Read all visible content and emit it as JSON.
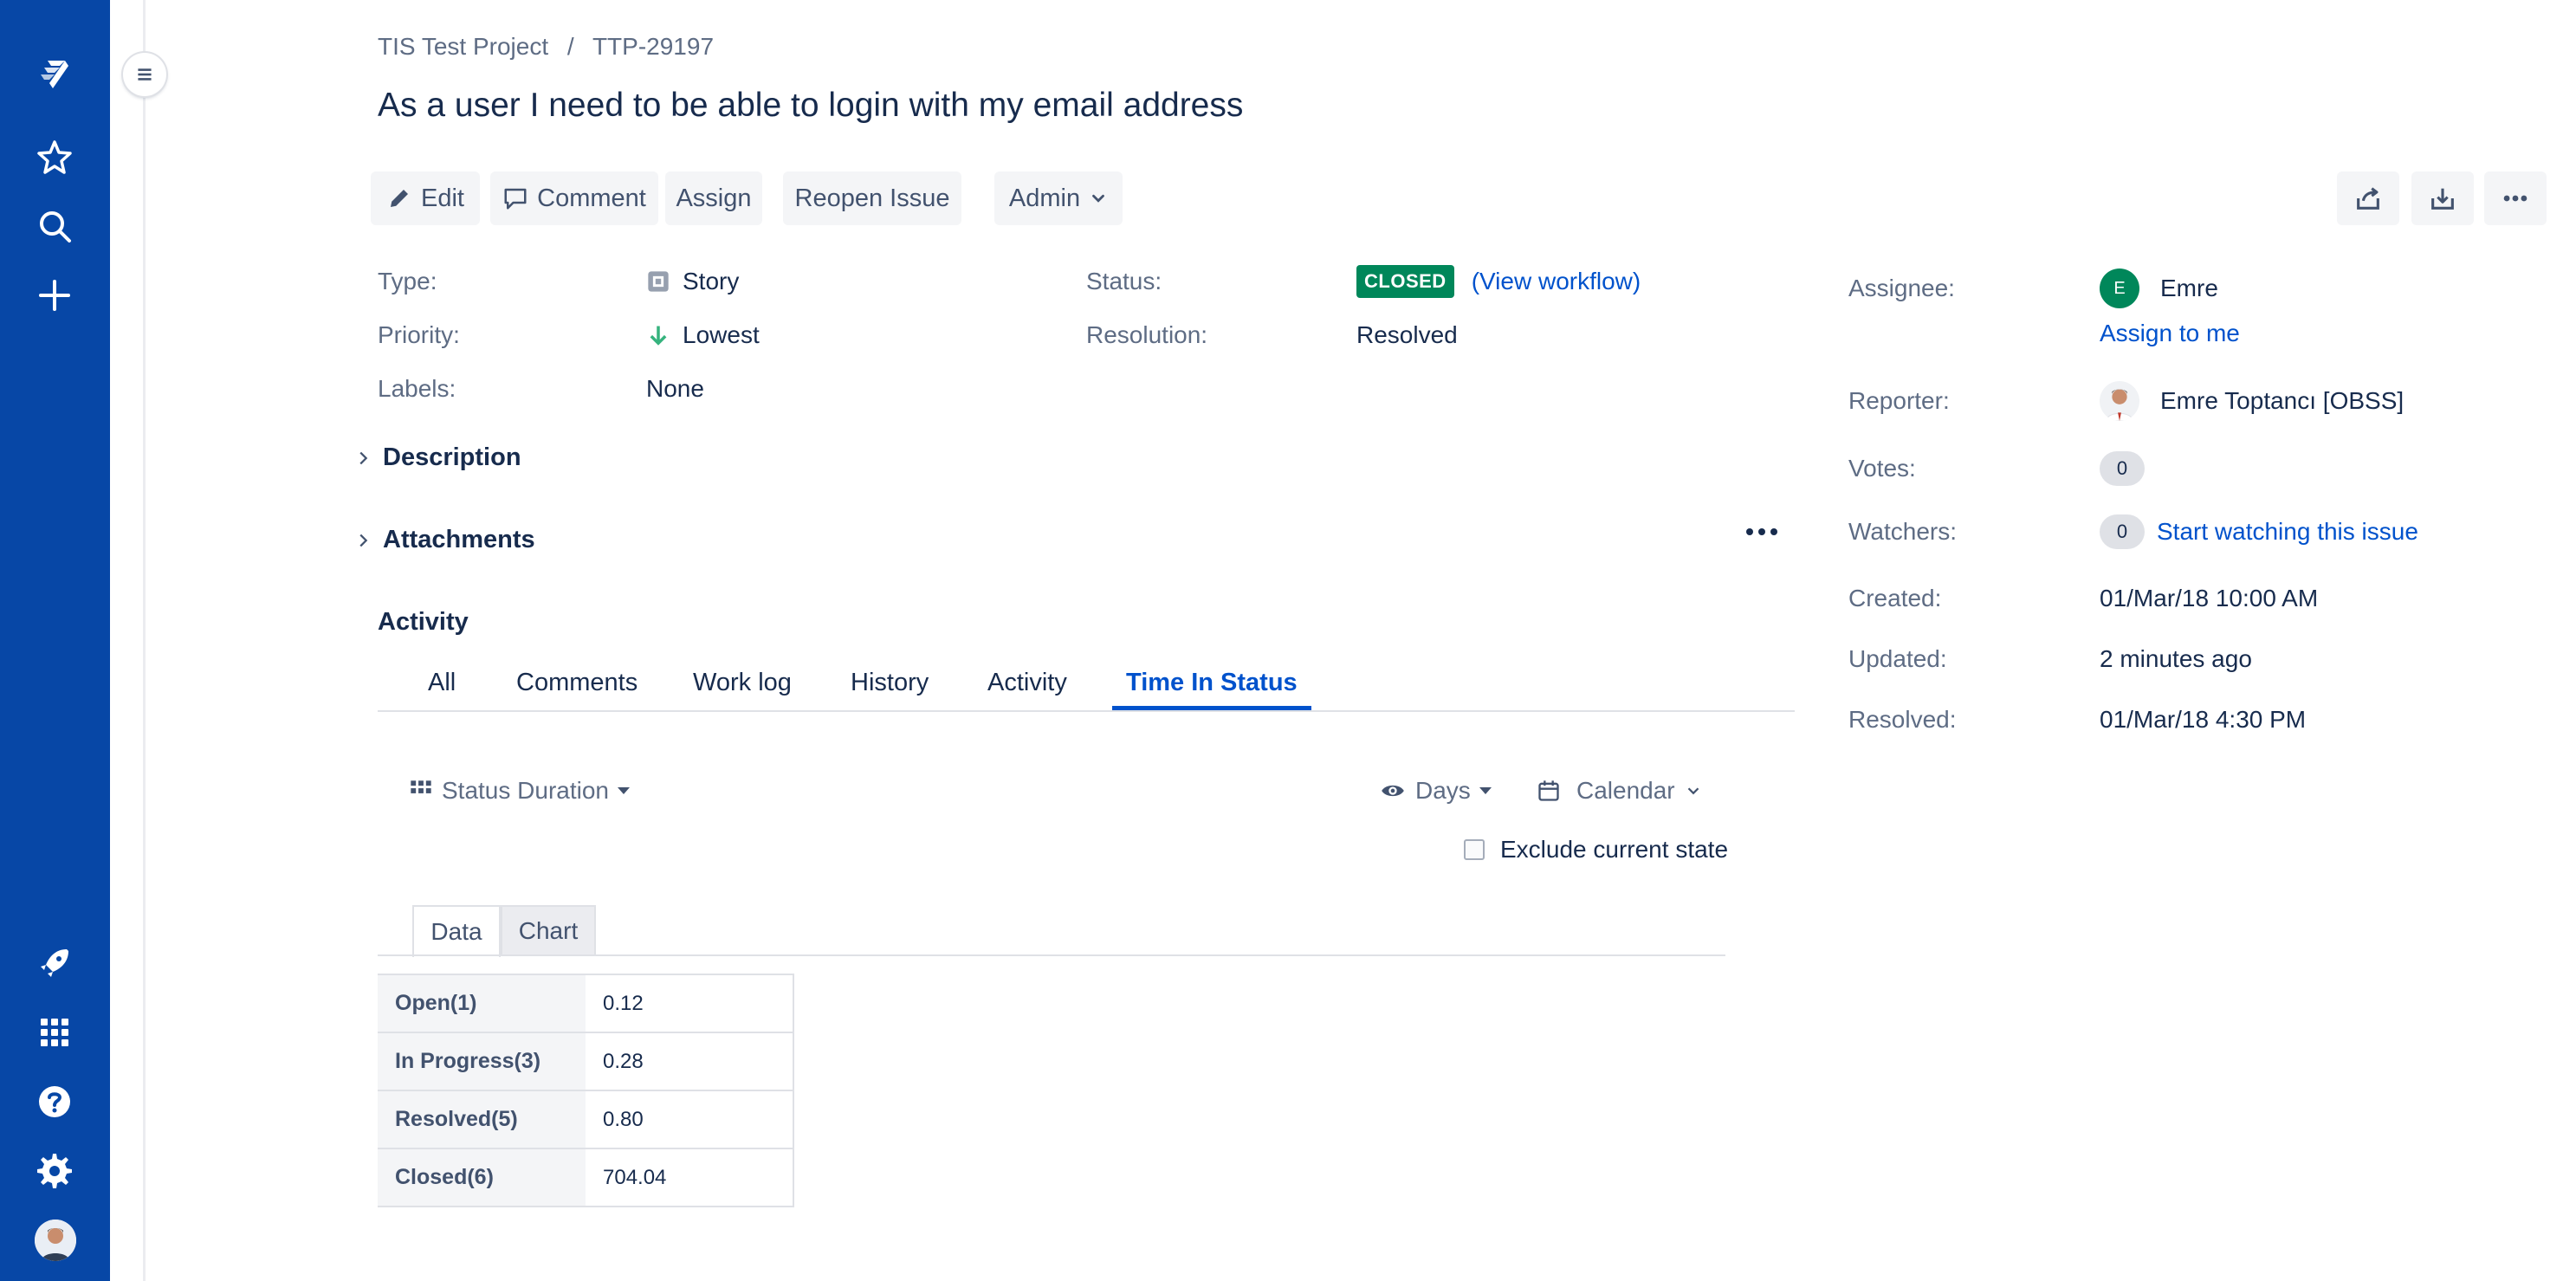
{
  "breadcrumb": {
    "project": "TIS Test Project",
    "separator": "/",
    "issue_key": "TTP-29197"
  },
  "issue_title": "As a user I need to be able to login with my email address",
  "toolbar": {
    "edit": "Edit",
    "comment": "Comment",
    "assign": "Assign",
    "reopen": "Reopen Issue",
    "admin": "Admin"
  },
  "details": {
    "type_label": "Type:",
    "type_value": "Story",
    "priority_label": "Priority:",
    "priority_value": "Lowest",
    "labels_label": "Labels:",
    "labels_value": "None",
    "status_label": "Status:",
    "status_value": "CLOSED",
    "view_workflow": "(View workflow)",
    "resolution_label": "Resolution:",
    "resolution_value": "Resolved"
  },
  "people": {
    "assignee_label": "Assignee:",
    "assignee_initial": "E",
    "assignee_name": "Emre",
    "assign_to_me": "Assign to me",
    "reporter_label": "Reporter:",
    "reporter_name": "Emre Toptancı [OBSS]",
    "votes_label": "Votes:",
    "votes_count": "0",
    "watchers_label": "Watchers:",
    "watchers_count": "0",
    "start_watching": "Start watching this issue"
  },
  "dates": {
    "created_label": "Created:",
    "created_value": "01/Mar/18 10:00 AM",
    "updated_label": "Updated:",
    "updated_value": "2 minutes ago",
    "resolved_label": "Resolved:",
    "resolved_value": "01/Mar/18 4:30 PM"
  },
  "sections": {
    "description": "Description",
    "attachments": "Attachments",
    "activity": "Activity"
  },
  "activity_tabs": [
    "All",
    "Comments",
    "Work log",
    "History",
    "Activity",
    "Time In Status"
  ],
  "time_in_status": {
    "view_selector": "Status Duration",
    "unit_selector": "Days",
    "calendar_selector": "Calendar",
    "exclude_current": "Exclude current state",
    "subtabs": [
      "Data",
      "Chart"
    ],
    "rows": [
      {
        "status": "Open(1)",
        "value": "0.12"
      },
      {
        "status": "In Progress(3)",
        "value": "0.28"
      },
      {
        "status": "Resolved(5)",
        "value": "0.80"
      },
      {
        "status": "Closed(6)",
        "value": "704.04"
      }
    ]
  },
  "colors": {
    "nav_bg": "#0747a6",
    "link": "#0052cc",
    "closed_lozenge": "#00875a",
    "avatar_green": "#00875a"
  },
  "icons": {
    "nav": [
      "jira-logo-icon",
      "star-icon",
      "search-icon",
      "plus-icon",
      "rocket-icon",
      "app-switcher-icon",
      "help-icon",
      "gear-icon",
      "user-avatar"
    ],
    "toolbar_right": [
      "share-icon",
      "export-icon",
      "more-icon"
    ]
  }
}
